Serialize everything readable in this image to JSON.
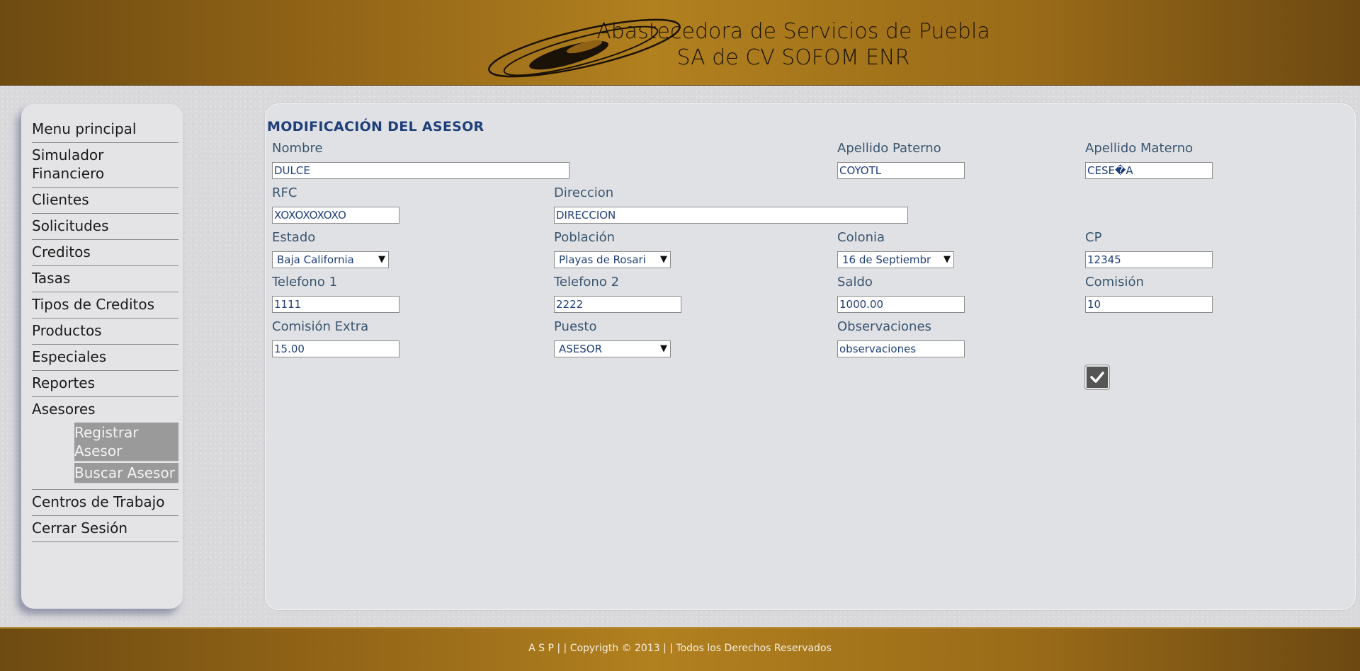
{
  "header": {
    "line1": "Abastecedora de Servicios de Puebla",
    "line2": "SA de CV SOFOM ENR"
  },
  "sidebar": {
    "items": [
      {
        "label": "Menu principal"
      },
      {
        "label": "Simulador Financiero"
      },
      {
        "label": "Clientes"
      },
      {
        "label": "Solicitudes"
      },
      {
        "label": "Creditos"
      },
      {
        "label": "Tasas"
      },
      {
        "label": "Tipos de Creditos"
      },
      {
        "label": "Productos"
      },
      {
        "label": "Especiales"
      },
      {
        "label": "Reportes"
      },
      {
        "label": "Asesores",
        "subitems": [
          {
            "label": "Registrar Asesor"
          },
          {
            "label": "Buscar Asesor"
          }
        ]
      },
      {
        "label": "Centros de Trabajo"
      },
      {
        "label": "Cerrar Sesión"
      }
    ]
  },
  "form": {
    "title": "MODIFICACIÓN DEL ASESOR",
    "nombre": {
      "label": "Nombre",
      "value": "DULCE"
    },
    "apellido_paterno": {
      "label": "Apellido Paterno",
      "value": "COYOTL"
    },
    "apellido_materno": {
      "label": "Apellido Materno",
      "value": "CESE�A"
    },
    "rfc": {
      "label": "RFC",
      "value": "XOXOXOXOXO"
    },
    "direccion": {
      "label": "Direccion",
      "value": "DIRECCION"
    },
    "estado": {
      "label": "Estado",
      "value": "Baja California"
    },
    "poblacion": {
      "label": "Población",
      "value": "Playas de Rosari"
    },
    "colonia": {
      "label": "Colonia",
      "value": "16 de Septiembr"
    },
    "cp": {
      "label": "CP",
      "value": "12345"
    },
    "telefono1": {
      "label": "Telefono 1",
      "value": "1111"
    },
    "telefono2": {
      "label": "Telefono 2",
      "value": "2222"
    },
    "saldo": {
      "label": "Saldo",
      "value": "1000.00"
    },
    "comision": {
      "label": "Comisión",
      "value": "10"
    },
    "comision_extra": {
      "label": "Comisión Extra",
      "value": "15.00"
    },
    "puesto": {
      "label": "Puesto",
      "value": "ASESOR"
    },
    "observaciones": {
      "label": "Observaciones",
      "value": "observaciones"
    },
    "submit_icon": "check-icon"
  },
  "footer": {
    "text": "A S P | | Copyrigth © 2013 | | Todos los Derechos Reservados"
  },
  "colors": {
    "header_gold": "#b1801f",
    "title_blue": "#1f3f7a",
    "label_blue": "#3a5570"
  }
}
